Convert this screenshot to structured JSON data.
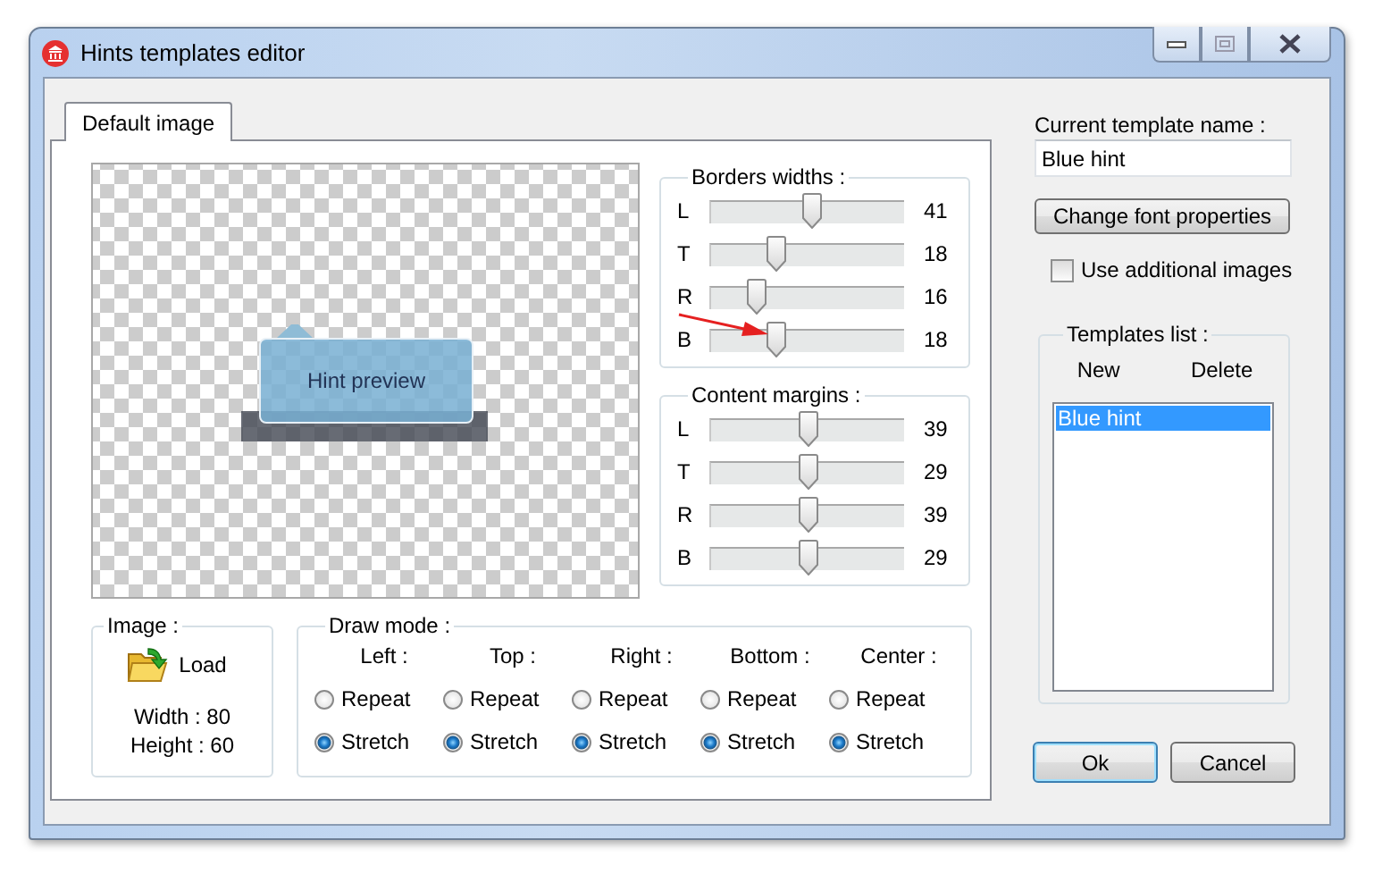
{
  "window": {
    "title": "Hints templates editor"
  },
  "tabs": [
    {
      "label": "Default image",
      "selected": true
    }
  ],
  "preview": {
    "hint_text": "Hint preview"
  },
  "borders_widths": {
    "title": "Borders widths :",
    "sliders": [
      {
        "label": "L",
        "level": 0.52,
        "value": "41"
      },
      {
        "label": "T",
        "level": 0.31,
        "value": "18"
      },
      {
        "label": "R",
        "level": 0.2,
        "value": "16"
      },
      {
        "label": "B",
        "level": 0.31,
        "value": "18"
      }
    ]
  },
  "content_margins": {
    "title": "Content margins :",
    "sliders": [
      {
        "label": "L",
        "level": 0.49,
        "value": "39"
      },
      {
        "label": "T",
        "level": 0.49,
        "value": "29"
      },
      {
        "label": "R",
        "level": 0.49,
        "value": "39"
      },
      {
        "label": "B",
        "level": 0.49,
        "value": "29"
      }
    ]
  },
  "image": {
    "title": "Image :",
    "load_button": "Load",
    "width": "Width :  80",
    "height": "Height :  60"
  },
  "draw_mode": {
    "title": "Draw mode :",
    "columns": [
      {
        "header": "Left :",
        "options": [
          {
            "label": "Repeat",
            "selected": false
          },
          {
            "label": "Stretch",
            "selected": true
          }
        ]
      },
      {
        "header": "Top :",
        "options": [
          {
            "label": "Repeat",
            "selected": false
          },
          {
            "label": "Stretch",
            "selected": true
          }
        ]
      },
      {
        "header": "Right :",
        "options": [
          {
            "label": "Repeat",
            "selected": false
          },
          {
            "label": "Stretch",
            "selected": true
          }
        ]
      },
      {
        "header": "Bottom :",
        "options": [
          {
            "label": "Repeat",
            "selected": false
          },
          {
            "label": "Stretch",
            "selected": true
          }
        ]
      },
      {
        "header": "Center :",
        "options": [
          {
            "label": "Repeat",
            "selected": false
          },
          {
            "label": "Stretch",
            "selected": true
          }
        ]
      }
    ]
  },
  "template_name": {
    "label": "Current template name :",
    "value": "Blue hint"
  },
  "change_font_button": "Change font properties",
  "use_additional_images": {
    "label": "Use additional images",
    "checked": false
  },
  "templates_list": {
    "title": "Templates list :",
    "actions": [
      "New",
      "Delete"
    ],
    "items": [
      {
        "label": "Blue hint",
        "selected": true
      }
    ]
  },
  "buttons": [
    {
      "label": "Ok",
      "default": true
    },
    {
      "label": "Cancel",
      "default": false
    }
  ]
}
